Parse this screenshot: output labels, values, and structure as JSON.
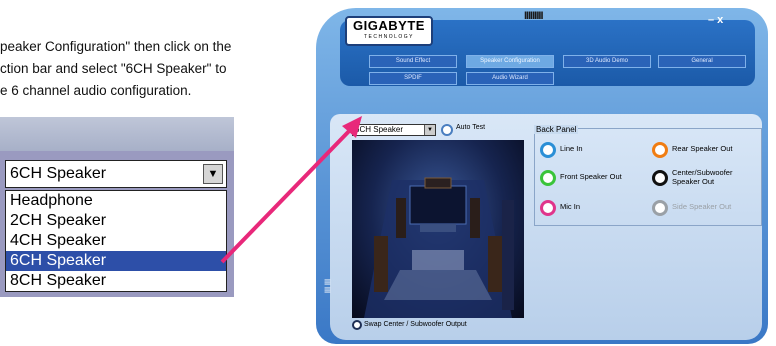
{
  "instructions": {
    "line1": "peaker Configuration\" then click on the",
    "line2": "ction bar and select \"6CH Speaker\" to",
    "line3": "e 6 channel audio configuration."
  },
  "zoom_dropdown": {
    "selected": "6CH Speaker",
    "options": [
      "Headphone",
      "2CH Speaker",
      "4CH Speaker",
      "6CH Speaker",
      "8CH Speaker"
    ],
    "highlighted_index": 3
  },
  "app": {
    "logo": "GIGABYTE",
    "logo_sub": "TECHNOLOGY",
    "title_marks": "IIIIIIIII",
    "window_controls": "– x",
    "tabs_row1": [
      "Sound Effect",
      "Speaker Configuration",
      "3D Audio Demo",
      "General"
    ],
    "tabs_row2": [
      "SPDIF",
      "Audio Wizard"
    ],
    "active_tab": "Speaker Configuration",
    "speaker_select": "6CH Speaker",
    "auto_test": "Auto Test",
    "swap_label": "Swap Center / Subwoofer Output",
    "back_panel": {
      "title": "Back Panel",
      "jacks": [
        {
          "label": "Line In",
          "color": "#2b8fd6"
        },
        {
          "label": "Rear Speaker Out",
          "color": "#f07d12"
        },
        {
          "label": "Front Speaker Out",
          "color": "#3ac43a"
        },
        {
          "label": "Center/Subwoofer Speaker Out",
          "color": "#111111"
        },
        {
          "label": "Mic In",
          "color": "#e0348b"
        },
        {
          "label": "Side Speaker Out",
          "color": "#9aa0a6"
        }
      ]
    }
  },
  "colors": {
    "accent": "#2d4fa8",
    "arrow": "#e8287a"
  }
}
